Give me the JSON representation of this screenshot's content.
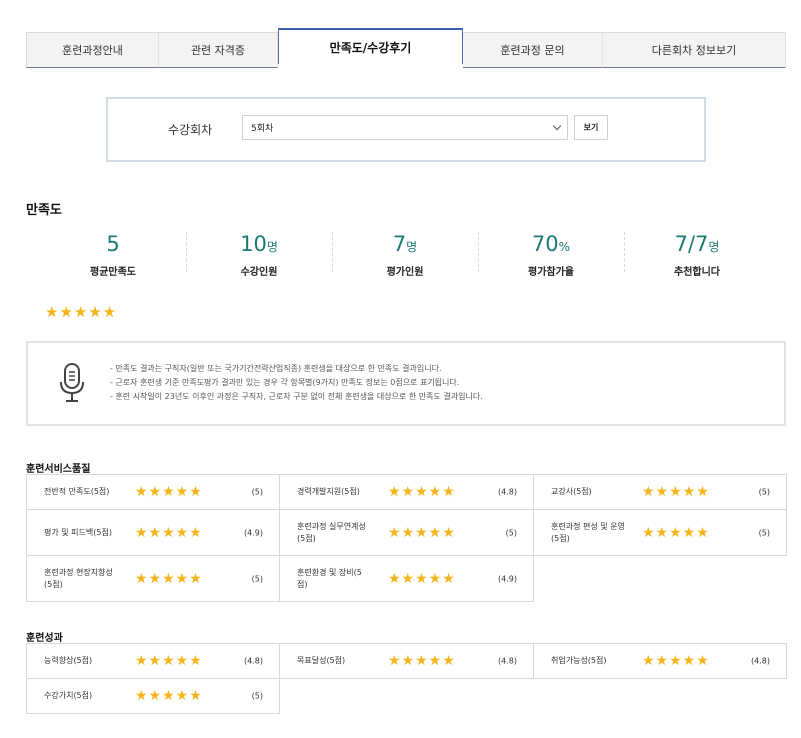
{
  "tabs": [
    "훈련과정안내",
    "관련 자격증",
    "만족도/수강후기",
    "훈련과정 문의",
    "다른회차 정보보기"
  ],
  "filter": {
    "label": "수강회차",
    "selected": "5회차",
    "button": "보기"
  },
  "satisfaction": {
    "title": "만족도",
    "stats": [
      {
        "value": "5",
        "unit": "",
        "label": "평균만족도"
      },
      {
        "value": "10",
        "unit": "명",
        "label": "수강인원"
      },
      {
        "value": "7",
        "unit": "명",
        "label": "평가인원"
      },
      {
        "value": "70",
        "unit": "%",
        "label": "평가참가율"
      },
      {
        "value": "7/7",
        "unit": "명",
        "label": "추천합니다"
      }
    ],
    "average_stars": 5
  },
  "notice": {
    "icon": "microphone-icon",
    "lines": [
      "- 만족도 결과는 구직자(일반 또는 국가기간전략산업직종) 훈련생을 대상으로 한 만족도 결과입니다.",
      "- 근로자 훈련생 기준 만족도평가 결과만 있는 경우 각 항목별(9가지) 만족도 정보는 0점으로 표기됩니다.",
      "- 훈련 시작일이 23년도 이후인 과정은 구직자, 근로자 구분 없이 전체 훈련생을 대상으로 한 만족도 결과입니다."
    ]
  },
  "groups": [
    {
      "title": "훈련서비스품질",
      "items": [
        {
          "name": "전반적 만족도(5점)",
          "score": "(5)"
        },
        {
          "name": "경력개발지원(5점)",
          "score": "(4.8)"
        },
        {
          "name": "교강사(5점)",
          "score": "(5)"
        },
        {
          "name": "평가 및 피드백(5점)",
          "score": "(4.9)"
        },
        {
          "name": "훈련과정 실무연계성(5점)",
          "score": "(5)"
        },
        {
          "name": "훈련과정 편성 및 운영(5점)",
          "score": "(5)"
        },
        {
          "name": "훈련과정 현장지향성(5점)",
          "score": "(5)"
        },
        {
          "name": "훈련환경 및 장비(5점)",
          "score": "(4.9)"
        }
      ]
    },
    {
      "title": "훈련성과",
      "items": [
        {
          "name": "능력향상(5점)",
          "score": "(4.8)"
        },
        {
          "name": "목표달성(5점)",
          "score": "(4.8)"
        },
        {
          "name": "취업가능성(5점)",
          "score": "(4.8)"
        },
        {
          "name": "수강가치(5점)",
          "score": "(5)"
        }
      ]
    }
  ],
  "colors": {
    "accent": "#1d7a72",
    "star": "#f4b41a",
    "tab_active": "#3b64b0"
  }
}
